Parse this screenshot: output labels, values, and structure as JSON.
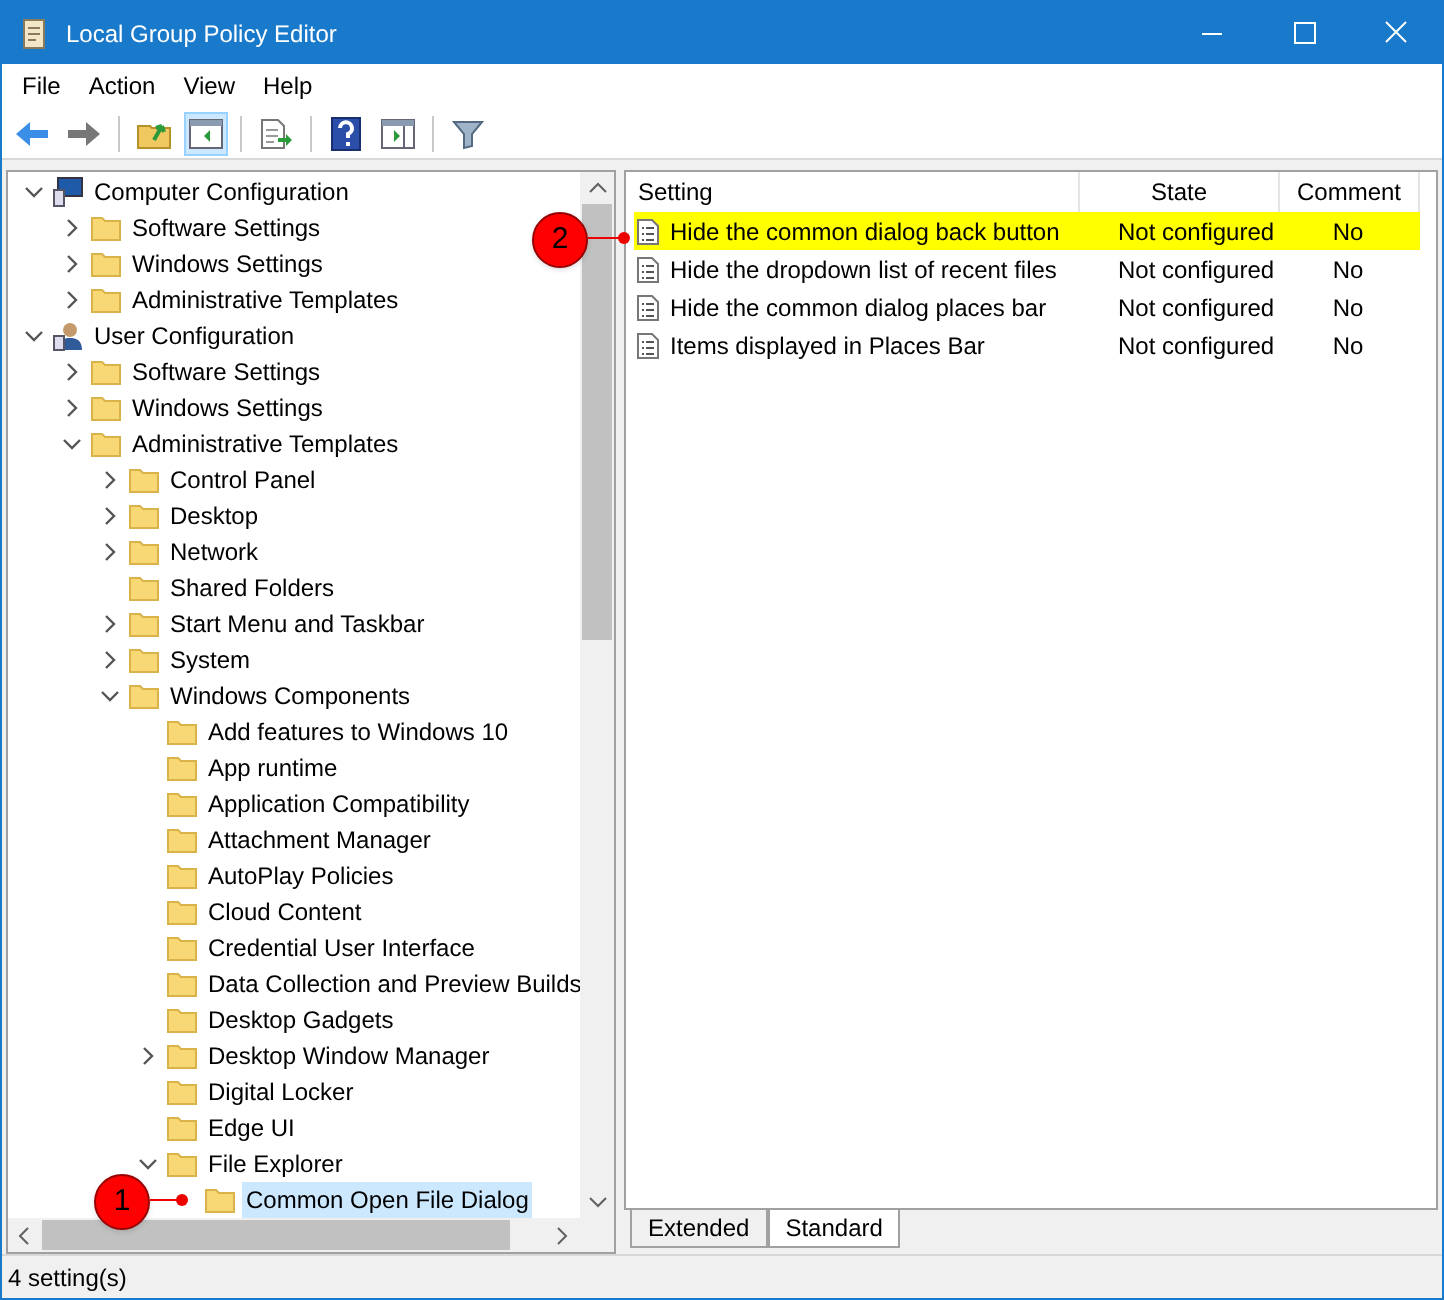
{
  "window": {
    "title": "Local Group Policy Editor"
  },
  "menu": [
    {
      "label": "File"
    },
    {
      "label": "Action"
    },
    {
      "label": "View"
    },
    {
      "label": "Help"
    }
  ],
  "toolbar": [
    {
      "kind": "back",
      "pressed": false
    },
    {
      "kind": "forward",
      "pressed": false
    },
    {
      "kind": "separator"
    },
    {
      "kind": "up",
      "pressed": false
    },
    {
      "kind": "tree",
      "pressed": true
    },
    {
      "kind": "separator"
    },
    {
      "kind": "export",
      "pressed": false
    },
    {
      "kind": "separator"
    },
    {
      "kind": "help",
      "pressed": false
    },
    {
      "kind": "pane",
      "pressed": false
    },
    {
      "kind": "separator"
    },
    {
      "kind": "filter",
      "pressed": false
    }
  ],
  "tree": [
    {
      "label": "Computer Configuration",
      "kind": "computer",
      "expanded": true,
      "selected": false,
      "children": [
        {
          "label": "Software Settings",
          "kind": "folder",
          "expanded": false,
          "selected": false
        },
        {
          "label": "Windows Settings",
          "kind": "folder",
          "expanded": false,
          "selected": false
        },
        {
          "label": "Administrative Templates",
          "kind": "folder",
          "expanded": false,
          "selected": false
        }
      ]
    },
    {
      "label": "User Configuration",
      "kind": "user",
      "expanded": true,
      "selected": false,
      "children": [
        {
          "label": "Software Settings",
          "kind": "folder",
          "expanded": false,
          "selected": false
        },
        {
          "label": "Windows Settings",
          "kind": "folder",
          "expanded": false,
          "selected": false
        },
        {
          "label": "Administrative Templates",
          "kind": "folder",
          "expanded": true,
          "selected": false,
          "children": [
            {
              "label": "Control Panel",
              "kind": "folder",
              "expanded": false,
              "selected": false
            },
            {
              "label": "Desktop",
              "kind": "folder",
              "expanded": false,
              "selected": false
            },
            {
              "label": "Network",
              "kind": "folder",
              "expanded": false,
              "selected": false
            },
            {
              "label": "Shared Folders",
              "kind": "folder",
              "selected": false
            },
            {
              "label": "Start Menu and Taskbar",
              "kind": "folder",
              "expanded": false,
              "selected": false
            },
            {
              "label": "System",
              "kind": "folder",
              "expanded": false,
              "selected": false
            },
            {
              "label": "Windows Components",
              "kind": "folder",
              "expanded": true,
              "selected": false,
              "children": [
                {
                  "label": "Add features to Windows 10",
                  "kind": "folder",
                  "selected": false
                },
                {
                  "label": "App runtime",
                  "kind": "folder",
                  "selected": false
                },
                {
                  "label": "Application Compatibility",
                  "kind": "folder",
                  "selected": false
                },
                {
                  "label": "Attachment Manager",
                  "kind": "folder",
                  "selected": false
                },
                {
                  "label": "AutoPlay Policies",
                  "kind": "folder",
                  "selected": false
                },
                {
                  "label": "Cloud Content",
                  "kind": "folder",
                  "selected": false
                },
                {
                  "label": "Credential User Interface",
                  "kind": "folder",
                  "selected": false
                },
                {
                  "label": "Data Collection and Preview Builds",
                  "kind": "folder",
                  "selected": false
                },
                {
                  "label": "Desktop Gadgets",
                  "kind": "folder",
                  "selected": false
                },
                {
                  "label": "Desktop Window Manager",
                  "kind": "folder",
                  "expanded": false,
                  "selected": false
                },
                {
                  "label": "Digital Locker",
                  "kind": "folder",
                  "selected": false
                },
                {
                  "label": "Edge UI",
                  "kind": "folder",
                  "selected": false
                },
                {
                  "label": "File Explorer",
                  "kind": "folder",
                  "expanded": true,
                  "selected": false,
                  "children": [
                    {
                      "label": "Common Open File Dialog",
                      "kind": "folder",
                      "selected": true
                    }
                  ]
                }
              ]
            }
          ]
        }
      ]
    }
  ],
  "table": {
    "columns": [
      "Setting",
      "State",
      "Comment"
    ],
    "rows": [
      {
        "setting": "Hide the common dialog back button",
        "state": "Not configured",
        "comment": "No",
        "highlighted": true
      },
      {
        "setting": "Hide the dropdown list of recent files",
        "state": "Not configured",
        "comment": "No",
        "highlighted": false
      },
      {
        "setting": "Hide the common dialog places bar",
        "state": "Not configured",
        "comment": "No",
        "highlighted": false
      },
      {
        "setting": "Items displayed in Places Bar",
        "state": "Not configured",
        "comment": "No",
        "highlighted": false
      }
    ]
  },
  "tabs": [
    {
      "label": "Extended",
      "selected": false
    },
    {
      "label": "Standard",
      "selected": true
    }
  ],
  "callouts": [
    {
      "label": "1"
    },
    {
      "label": "2"
    }
  ],
  "status_bar": {
    "text": "4 setting(s)"
  }
}
